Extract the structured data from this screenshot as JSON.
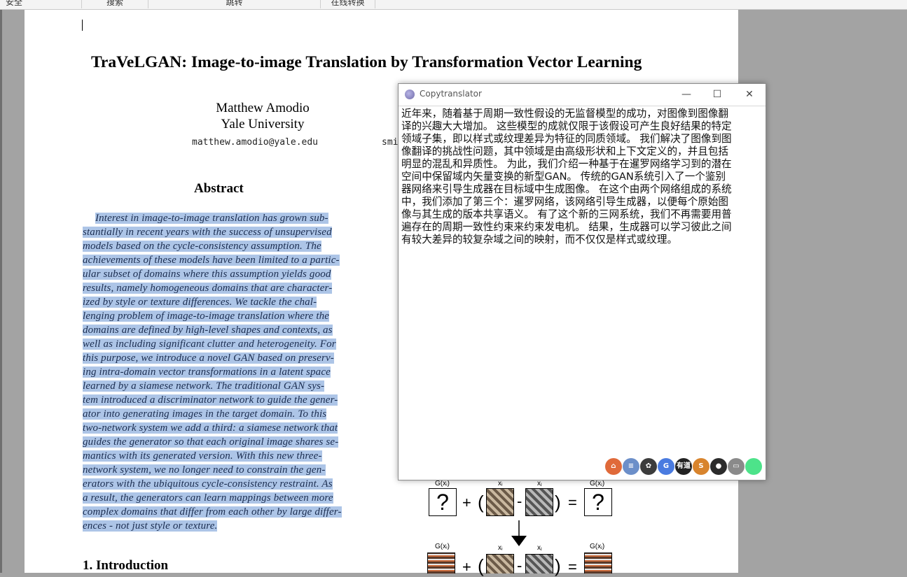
{
  "toolbar": {
    "items": [
      "安全",
      "搜索",
      "跳转",
      "在线转换"
    ]
  },
  "paper": {
    "title": "TraVeLGAN: Image-to-image Translation by Transformation Vector Learning",
    "author_name": "Matthew Amodio",
    "affiliation": "Yale University",
    "email": "matthew.amodio@yale.edu",
    "second_email_fragment": "smi",
    "abstract_heading": "Abstract",
    "abstract_lines": [
      "Interest in image-to-image translation has grown sub-",
      "stantially in recent years with the success of unsupervised",
      "models based on the cycle-consistency assumption.  The",
      "achievements of these models have been limited to a partic-",
      "ular subset of domains where this assumption yields good",
      "results, namely homogeneous domains that are character-",
      "ized by style or texture differences.  We tackle the chal-",
      "lenging problem of image-to-image translation where the",
      "domains are defined by high-level shapes and contexts, as",
      "well as including significant clutter and heterogeneity. For",
      "this purpose, we introduce a novel GAN based on preserv-",
      "ing intra-domain vector transformations in a latent space",
      "learned by a siamese network.  The traditional GAN sys-",
      "tem introduced a discriminator network to guide the gener-",
      "ator into generating images in the target domain.  To this",
      "two-network system we add a third: a siamese network that",
      "guides the generator so that each original image shares se-",
      "mantics with its generated version.  With this new three-",
      "network system, we no longer need to constrain the gen-",
      "erators with the ubiquitous cycle-consistency restraint. As",
      "a result, the generators can learn mappings between more",
      "complex domains that differ from each other by large differ-",
      "ences - not just style or texture."
    ],
    "intro_heading": "1. Introduction"
  },
  "figure": {
    "label_gxi": "G(xᵢ)",
    "label_xi": "xᵢ",
    "label_xj": "xⱼ",
    "label_gxj": "G(xⱼ)",
    "question": "?",
    "plus": "+",
    "minus": "-",
    "equals": "=",
    "open_paren": "(",
    "close_paren": ")"
  },
  "translator": {
    "window_title": "Copytranslator",
    "minimize": "—",
    "maximize": "☐",
    "close": "✕",
    "lines": [
      "近年来，随着基于周期一致性假设的无监督模型的成功，对图像到图像翻",
      "译的兴趣大大增加。 这些模型的成就仅限于该假设可产生良好结果的特定",
      "领域子集，即以样式或纹理差异为特征的同质领域。 我们解决了图像到图",
      "像翻译的挑战性问题，其中领域是由高级形状和上下文定义的，并且包括",
      "明显的混乱和异质性。 为此，我们介绍一种基于在暹罗网络学习到的潜在",
      "空间中保留域内矢量变换的新型GAN。 传统的GAN系统引入了一个鉴别",
      "器网络来引导生成器在目标域中生成图像。 在这个由两个网络组成的系统",
      "中，我们添加了第三个：暹罗网络，该网络引导生成器，以便每个原始图",
      "像与其生成的版本共享语义。 有了这个新的三网系统，我们不再需要用普",
      "遍存在的周期一致性约束来约束发电机。 结果，生成器可以学习彼此之间",
      "有较大差异的较复杂域之间的映射，而不仅仅是样式或纹理。"
    ],
    "engines": [
      {
        "name": "home-icon",
        "label": "⌂",
        "color": "#e06a3a"
      },
      {
        "name": "doc-icon",
        "label": "≡",
        "color": "#6c8fc9"
      },
      {
        "name": "baidu-icon",
        "label": "✿",
        "color": "#3c3c3c"
      },
      {
        "name": "google-icon",
        "label": "G",
        "color": "#4a7be0"
      },
      {
        "name": "youdao-icon",
        "label": "有道",
        "color": "#222222"
      },
      {
        "name": "sogou-icon",
        "label": "S",
        "color": "#d8842d"
      },
      {
        "name": "tencent-icon",
        "label": "●",
        "color": "#2b2b2b"
      },
      {
        "name": "chat-icon",
        "label": "▭",
        "color": "#8a8a8a"
      },
      {
        "name": "status-dot-icon",
        "label": "",
        "color": "#4de38a"
      }
    ]
  }
}
